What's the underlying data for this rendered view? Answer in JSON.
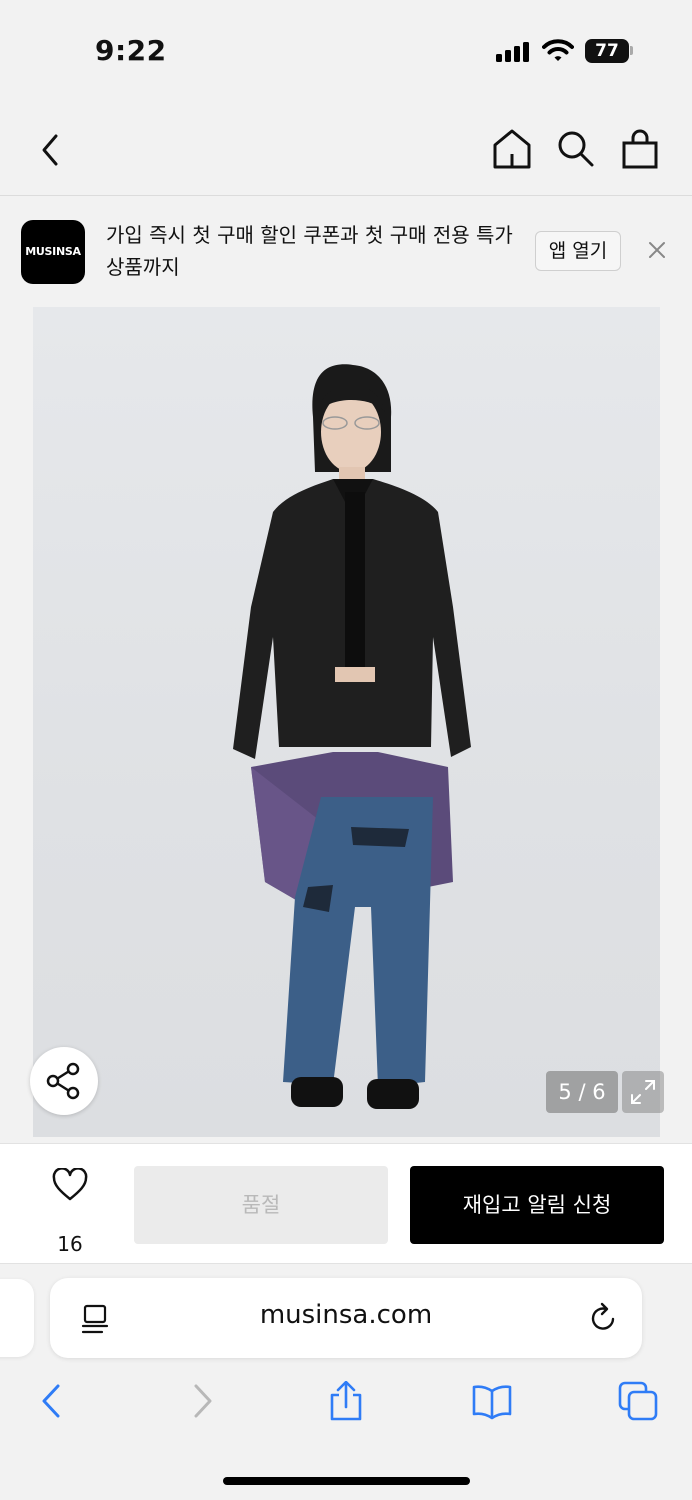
{
  "status_bar": {
    "time": "9:22",
    "battery": "77"
  },
  "banner": {
    "logo_text": "MUSINSA",
    "promo_text": "가입 즉시 첫 구매 할인 쿠폰과 첫 구매 전용 특가 상품까지",
    "open_app_label": "앱 열기"
  },
  "gallery": {
    "counter": "5 / 6"
  },
  "actions": {
    "like_count": "16",
    "soldout_label": "품절",
    "restock_label": "재입고 알림 신청"
  },
  "browser": {
    "url": "musinsa.com"
  },
  "colors": {
    "accent_blue": "#2f7cf6",
    "brand_black": "#000000"
  }
}
